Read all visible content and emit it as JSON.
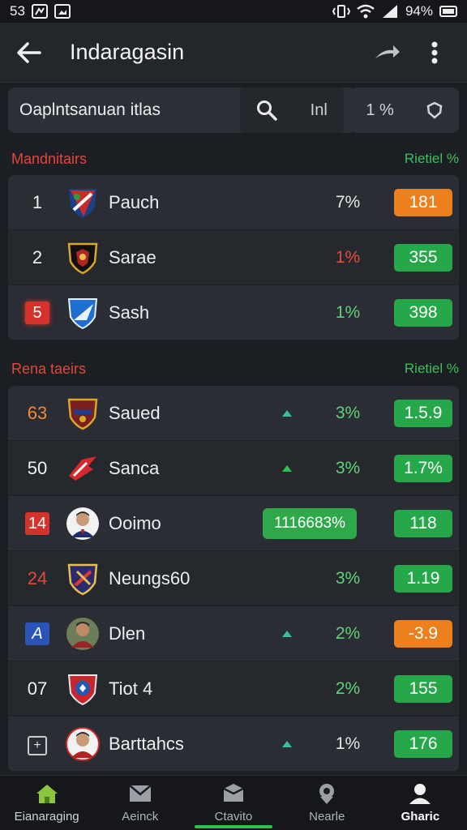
{
  "status_bar": {
    "left_text": "53",
    "battery": "94%"
  },
  "app_bar": {
    "title": "Indaragasin"
  },
  "search": {
    "placeholder": "Oaplntsanuan itlas",
    "segment_label": "Inl",
    "filter_label": "1 %"
  },
  "sections": [
    {
      "title": "Mandnitairs",
      "right_label": "Rietiel %",
      "rows": [
        {
          "rank": "1",
          "name": "Pauch",
          "pct": "7%",
          "score": "181",
          "score_color": "#ee7f1e"
        },
        {
          "rank": "2",
          "name": "Sarae",
          "pct": "1%",
          "score": "355",
          "score_color": "#26a84a"
        },
        {
          "rank": "5",
          "name": "Sash",
          "pct": "1%",
          "score": "398",
          "score_color": "#26a84a"
        }
      ]
    },
    {
      "title": "Rena taeirs",
      "right_label": "Rietiel %",
      "rows": [
        {
          "rank": "63",
          "name": "Saued",
          "pct": "3%",
          "score": "1.5.9",
          "score_color": "#26a84a"
        },
        {
          "rank": "50",
          "name": "Sanca",
          "pct": "3%",
          "score": "1.7%",
          "score_color": "#26a84a"
        },
        {
          "rank": "14",
          "name": "Ooimo",
          "pct": "1116683%",
          "score": "118",
          "score_color": "#26a84a"
        },
        {
          "rank": "24",
          "name": "Neungs60",
          "pct": "3%",
          "score": "1.19",
          "score_color": "#26a84a"
        },
        {
          "rank": "A",
          "name": "Dlen",
          "pct": "2%",
          "score": "-3.9",
          "score_color": "#ee7f1e"
        },
        {
          "rank": "07",
          "name": "Tiot 4",
          "pct": "2%",
          "score": "155",
          "score_color": "#26a84a"
        },
        {
          "rank": "+",
          "name": "Barttahcs",
          "pct": "1%",
          "score": "176",
          "score_color": "#26a84a"
        }
      ]
    }
  ],
  "nav": [
    {
      "label": "Eianaraging",
      "icon": "home-icon"
    },
    {
      "label": "Aeinck",
      "icon": "inbox-icon"
    },
    {
      "label": "Ctavito",
      "icon": "box-icon"
    },
    {
      "label": "Nearle",
      "icon": "location-icon"
    },
    {
      "label": "Gharic",
      "icon": "profile-icon"
    }
  ]
}
